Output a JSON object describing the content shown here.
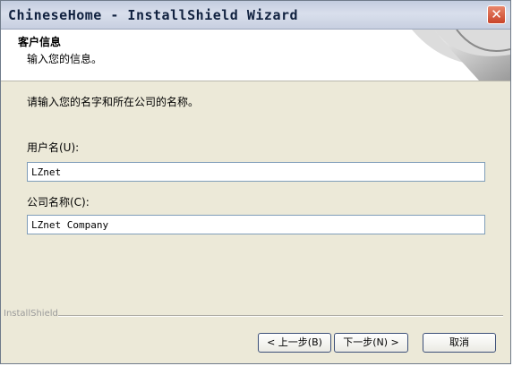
{
  "window": {
    "title": "ChineseHome - InstallShield Wizard",
    "close_glyph": "✕"
  },
  "header": {
    "title": "客户信息",
    "subtitle": "输入您的信息。"
  },
  "instruction": "请输入您的名字和所在公司的名称。",
  "form": {
    "username_label": "用户名(U):",
    "username_value": "LZnet",
    "company_label": "公司名称(C):",
    "company_value": "LZnet Company"
  },
  "footer": {
    "brand": "InstallShield",
    "back_label": "< 上一步(B)",
    "next_label": "下一步(N) >",
    "cancel_label": "取消"
  },
  "icons": [
    "close-icon",
    "header-decoration"
  ],
  "colors": {
    "title_text": "#10213f",
    "close_button": "#c9442a",
    "dialog_bg": "#ece9d8"
  }
}
